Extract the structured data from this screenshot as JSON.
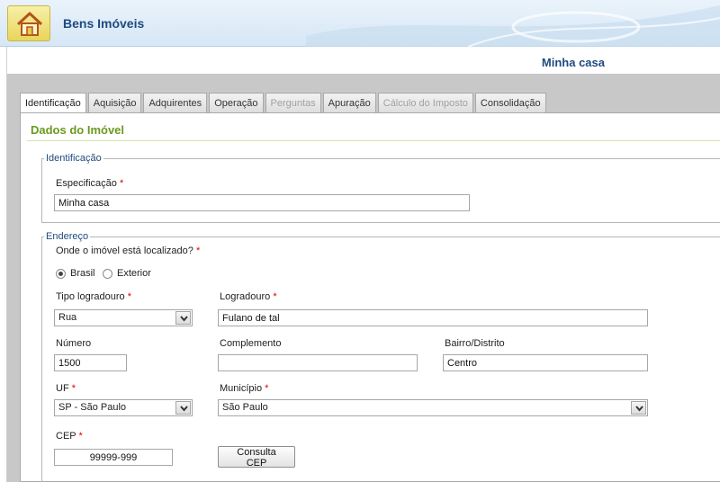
{
  "header": {
    "app_title": "Bens Imóveis",
    "home_icon": "home-icon"
  },
  "document": {
    "title": "Minha casa"
  },
  "tabs": [
    {
      "label": "Identificação",
      "state": "active"
    },
    {
      "label": "Aquisição",
      "state": "normal"
    },
    {
      "label": "Adquirentes",
      "state": "normal"
    },
    {
      "label": "Operação",
      "state": "normal"
    },
    {
      "label": "Perguntas",
      "state": "disabled"
    },
    {
      "label": "Apuração",
      "state": "normal"
    },
    {
      "label": "Cálculo do Imposto",
      "state": "disabled"
    },
    {
      "label": "Consolidação",
      "state": "normal"
    }
  ],
  "section": {
    "title": "Dados do Imóvel"
  },
  "identificacao": {
    "legend": "Identificação",
    "especificacao_label": "Especificação",
    "especificacao_value": "Minha casa"
  },
  "endereco": {
    "legend": "Endereço",
    "location_question": "Onde o imóvel está localizado?",
    "location_options": [
      "Brasil",
      "Exterior"
    ],
    "location_selected": "Brasil",
    "tipo_logradouro_label": "Tipo logradouro",
    "tipo_logradouro_value": "Rua",
    "logradouro_label": "Logradouro",
    "logradouro_value": "Fulano de tal",
    "numero_label": "Número",
    "numero_value": "1500",
    "complemento_label": "Complemento",
    "complemento_value": "",
    "bairro_label": "Bairro/Distrito",
    "bairro_value": "Centro",
    "uf_label": "UF",
    "uf_value": "SP - São Paulo",
    "municipio_label": "Município",
    "municipio_value": "São Paulo",
    "cep_label": "CEP",
    "cep_value": "99999-999",
    "consulta_cep_label": "Consulta CEP"
  },
  "required_marker": "*",
  "colors": {
    "accent_green": "#6a9a1f",
    "title_blue": "#1f4a80",
    "required_red": "#dd0000"
  }
}
